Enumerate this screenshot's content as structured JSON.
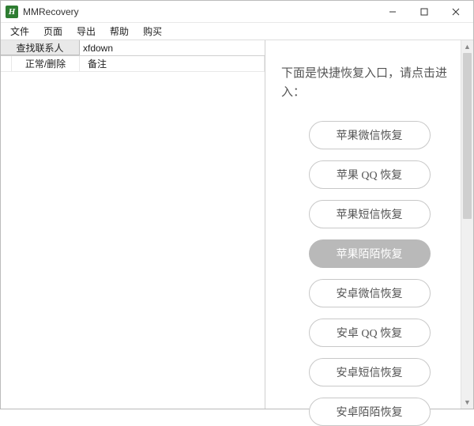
{
  "window": {
    "app_icon_letter": "H",
    "title": "MMRecovery",
    "controls": {
      "min": "–",
      "max": "□",
      "close": "✕"
    }
  },
  "menubar": {
    "items": [
      "文件",
      "页面",
      "导出",
      "帮助",
      "购买"
    ]
  },
  "left": {
    "search_button_label": "查找联系人",
    "search_value": "xfdown",
    "columns": {
      "c1": "",
      "c2": "正常/删除",
      "c3": "备注"
    }
  },
  "right": {
    "intro": "下面是快捷恢复入口，请点击进入：",
    "buttons": [
      {
        "label": "苹果微信恢复",
        "hover": false
      },
      {
        "label": "苹果 QQ 恢复",
        "hover": false
      },
      {
        "label": "苹果短信恢复",
        "hover": false
      },
      {
        "label": "苹果陌陌恢复",
        "hover": true
      },
      {
        "label": "安卓微信恢复",
        "hover": false
      },
      {
        "label": "安卓 QQ 恢复",
        "hover": false
      },
      {
        "label": "安卓短信恢复",
        "hover": false
      },
      {
        "label": "安卓陌陌恢复",
        "hover": false
      }
    ]
  }
}
